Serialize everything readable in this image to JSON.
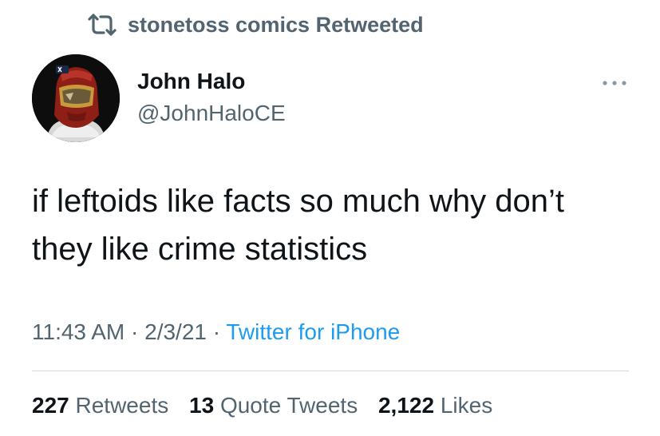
{
  "social_context": {
    "icon": "retweet-icon",
    "text": "stonetoss comics Retweeted"
  },
  "author": {
    "display_name": "John Halo",
    "handle": "@JohnHaloCE",
    "avatar_icon": "helmet-avatar"
  },
  "more_menu": {
    "icon": "more-dots-icon"
  },
  "tweet": {
    "text": "if leftoids like facts so much why don’t\nthey like crime statistics",
    "time": "11:43 AM",
    "separator": "·",
    "date": "2/3/21",
    "source": "Twitter for iPhone"
  },
  "stats": {
    "retweets_count": "227",
    "retweets_label": "Retweets",
    "quotes_count": "13",
    "quotes_label": "Quote Tweets",
    "likes_count": "2,122",
    "likes_label": "Likes"
  },
  "colors": {
    "primary_text": "#0f1419",
    "secondary_text": "#536471",
    "link": "#1d9bf0",
    "divider": "#cfd9de"
  }
}
